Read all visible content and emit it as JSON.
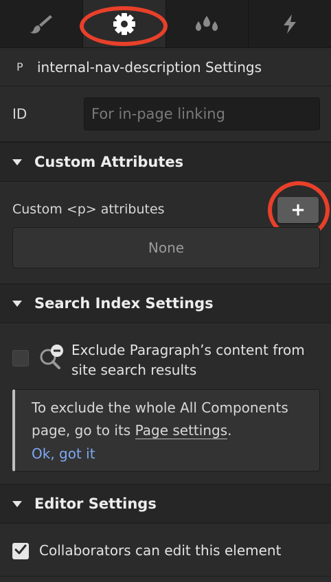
{
  "tabs": [
    {
      "icon": "brush-icon",
      "active": false
    },
    {
      "icon": "gear-icon",
      "active": true
    },
    {
      "icon": "drops-icon",
      "active": false
    },
    {
      "icon": "lightning-icon",
      "active": false
    }
  ],
  "element": {
    "tag_glyph": "P",
    "title": "internal-nav-description Settings"
  },
  "id_field": {
    "label": "ID",
    "value": "",
    "placeholder": "For in-page linking"
  },
  "custom_attributes": {
    "heading": "Custom Attributes",
    "label": "Custom <p> attributes",
    "add_label": "+",
    "empty_text": "None"
  },
  "search_index": {
    "heading": "Search Index Settings",
    "exclude_text": "Exclude Paragraph’s content from site search results",
    "exclude_checked": false,
    "info_text_before": "To exclude the whole All Components page, go to its ",
    "info_link": "Page settings",
    "info_text_after": ".",
    "dismiss_label": "Ok, got it"
  },
  "editor_settings": {
    "heading": "Editor Settings",
    "collab_label": "Collaborators can edit this element",
    "collab_checked": true
  },
  "colors": {
    "panel": "#2b2b2b",
    "tab_bar": "#1e1e1e",
    "highlight_ring": "#e8402a",
    "link": "#7da8f2"
  }
}
